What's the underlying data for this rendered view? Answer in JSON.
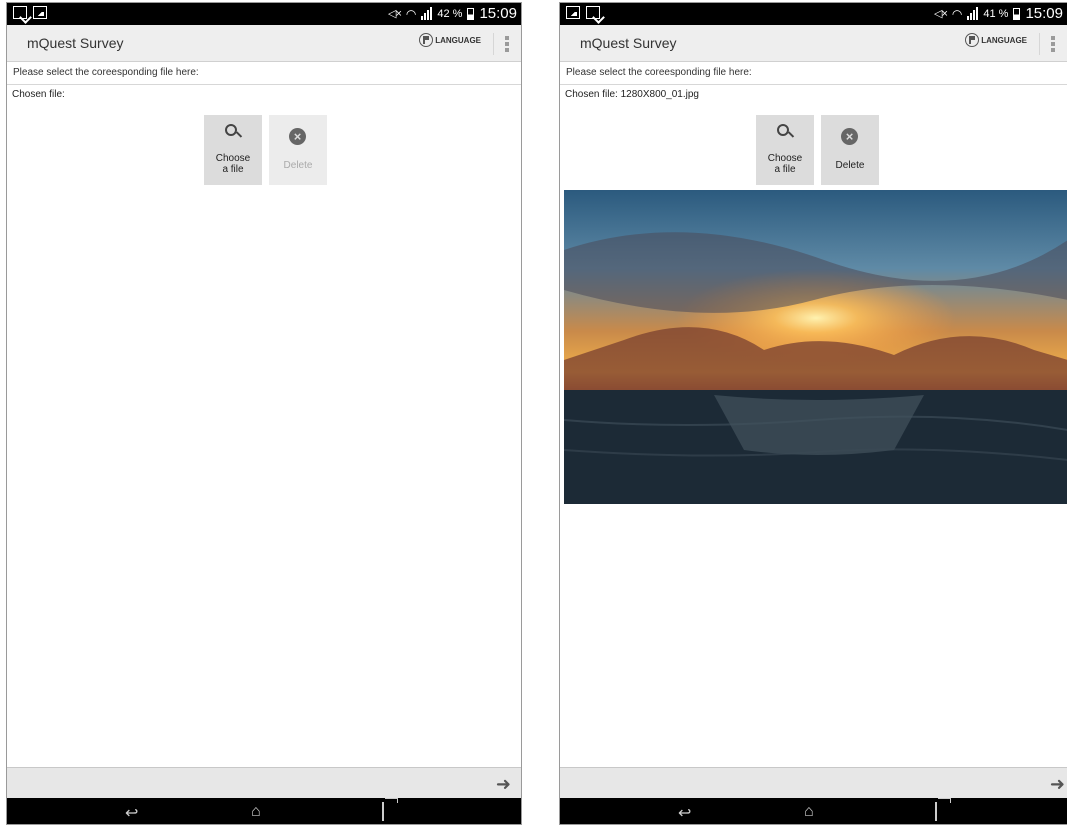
{
  "screens": [
    {
      "status_bar": {
        "battery_percent": "42 %",
        "time": "15:09"
      },
      "app_title": "mQuest Survey",
      "language_label": "LANGUAGE",
      "prompt": "Please select the coreesponding file here:",
      "chosen_file": "Chosen file:",
      "choose_button": {
        "line1": "Choose",
        "line2": "a file"
      },
      "delete_button": {
        "label": "Delete",
        "enabled": false
      }
    },
    {
      "status_bar": {
        "battery_percent": "41 %",
        "time": "15:09"
      },
      "app_title": "mQuest Survey",
      "language_label": "LANGUAGE",
      "prompt": "Please select the coreesponding file here:",
      "chosen_file": "Chosen file: 1280X800_01.jpg",
      "choose_button": {
        "line1": "Choose",
        "line2": "a file"
      },
      "delete_button": {
        "label": "Delete",
        "enabled": true
      }
    }
  ],
  "icons": {
    "status": [
      "image-notification-icon",
      "document-notification-icon",
      "mute-icon",
      "wifi-icon",
      "signal-icon",
      "battery-icon"
    ],
    "toolbar": [
      "flag-icon",
      "overflow-menu-icon"
    ],
    "buttons": [
      "search-icon",
      "delete-circle-icon"
    ],
    "bottom": [
      "next-arrow-icon",
      "nav-back-icon",
      "nav-home-icon",
      "nav-recent-apps-icon"
    ]
  },
  "colors": {
    "status_bar": "#000000",
    "action_bar": "#eeeeee",
    "button_bg": "#dcdcdc",
    "bottom_bar": "#e7e7e7"
  }
}
